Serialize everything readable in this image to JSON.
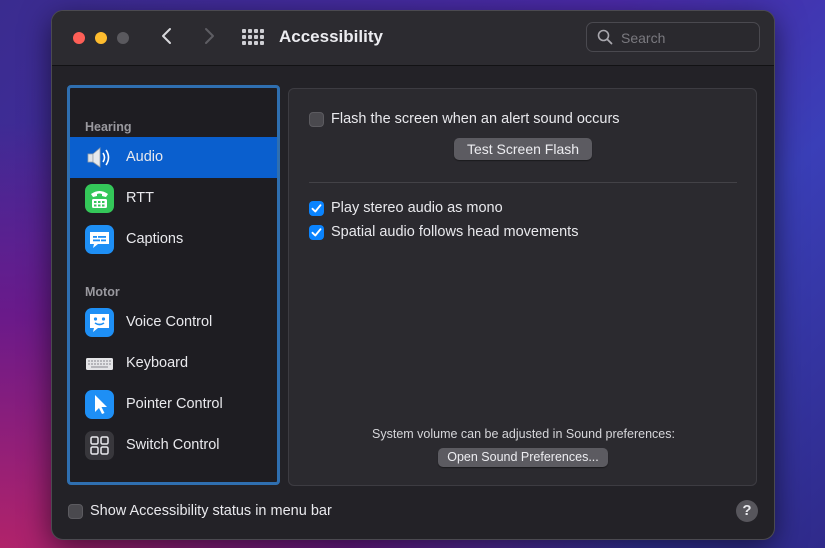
{
  "window": {
    "title": "Accessibility",
    "search_placeholder": "Search"
  },
  "sidebar": {
    "sections": [
      {
        "label": "Hearing"
      },
      {
        "label": "Motor"
      }
    ],
    "items": [
      {
        "label": "Audio",
        "icon": "speaker-icon",
        "selected": true
      },
      {
        "label": "RTT",
        "icon": "rtt-phone-icon",
        "selected": false
      },
      {
        "label": "Captions",
        "icon": "captions-icon",
        "selected": false
      },
      {
        "label": "Voice Control",
        "icon": "voice-control-icon",
        "selected": false
      },
      {
        "label": "Keyboard",
        "icon": "keyboard-icon",
        "selected": false
      },
      {
        "label": "Pointer Control",
        "icon": "pointer-icon",
        "selected": false
      },
      {
        "label": "Switch Control",
        "icon": "switch-control-icon",
        "selected": false
      }
    ]
  },
  "main": {
    "flash_screen": {
      "label": "Flash the screen when an alert sound occurs",
      "checked": false
    },
    "test_flash_button": "Test Screen Flash",
    "mono_audio": {
      "label": "Play stereo audio as mono",
      "checked": true
    },
    "spatial_audio": {
      "label": "Spatial audio follows head movements",
      "checked": true
    },
    "volume_note": "System volume can be adjusted in Sound preferences:",
    "open_sound_button": "Open Sound Preferences..."
  },
  "footer": {
    "status_in_menu_bar": {
      "label": "Show Accessibility status in menu bar",
      "checked": false
    },
    "help_label": "?"
  },
  "colors": {
    "accent": "#0a84ff",
    "selection": "#0a5fce",
    "sidebar_focus_ring": "#2f6fb0"
  }
}
